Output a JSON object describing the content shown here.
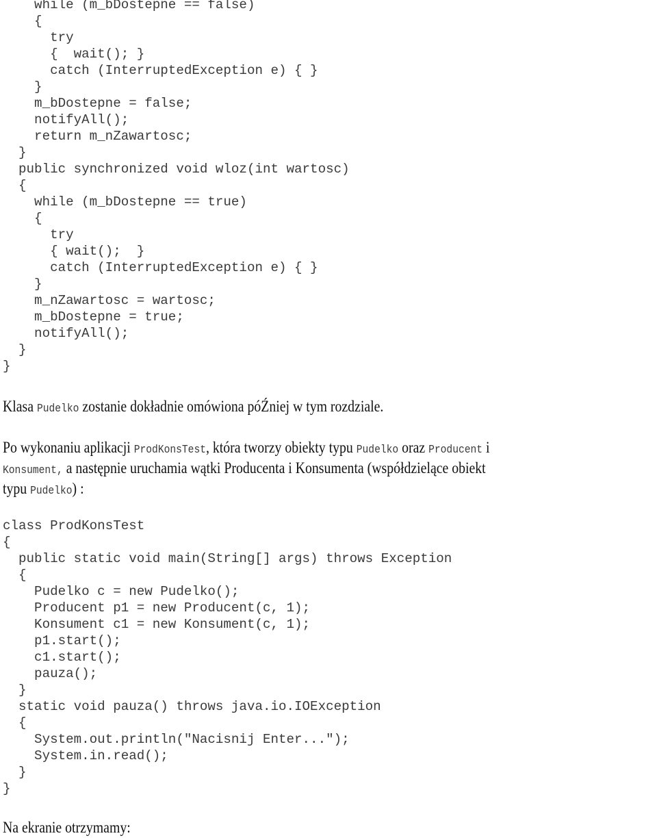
{
  "code_block_1": [
    "    while (m_bDostepne == false)",
    "    {",
    "      try",
    "      {  wait(); }",
    "      catch (InterruptedException e) { }",
    "    }",
    "    m_bDostepne = false;",
    "    notifyAll();",
    "    return m_nZawartosc;",
    "  }",
    "  public synchronized void wloz(int wartosc)",
    "  {",
    "    while (m_bDostepne == true)",
    "    {",
    "      try",
    "      { wait();  }",
    "      catch (InterruptedException e) { }",
    "    }",
    "    m_nZawartosc = wartosc;",
    "    m_bDostepne = true;",
    "    notifyAll();",
    "  }",
    "}"
  ],
  "paragraph_1": {
    "t1": "Klasa ",
    "c1": "Pudelko",
    "t2": " zostanie dokładnie omówiona póŹniej w tym rozdziale."
  },
  "paragraph_2": {
    "line1": {
      "t1": "Po wykonaniu aplikacji ",
      "c1": "ProdKonsTest",
      "t2": ", która tworzy obiekty typu ",
      "c2": "Pudelko",
      "t3": " oraz ",
      "c3": "Producent",
      "t4": " i"
    },
    "line2": {
      "c1": "Konsument,",
      "t1": " a następnie uruchamia wątki Producenta i Konsumenta (współdzielące obiekt"
    },
    "line3": {
      "t1": "typu ",
      "c1": "Pudelko",
      "t2": ") :"
    }
  },
  "code_block_2": [
    "class ProdKonsTest",
    "{",
    "  public static void main(String[] args) throws Exception",
    "  {",
    "    Pudelko c = new Pudelko();",
    "    Producent p1 = new Producent(c, 1);",
    "    Konsument c1 = new Konsument(c, 1);",
    "    p1.start();",
    "    c1.start();",
    "    pauza();",
    "  }",
    "  static void pauza() throws java.io.IOException",
    "  {",
    "    System.out.println(\"Nacisnij Enter...\");",
    "    System.in.read();",
    "  }",
    "}"
  ],
  "paragraph_3": {
    "t1": "Na ekranie otrzymamy:"
  }
}
